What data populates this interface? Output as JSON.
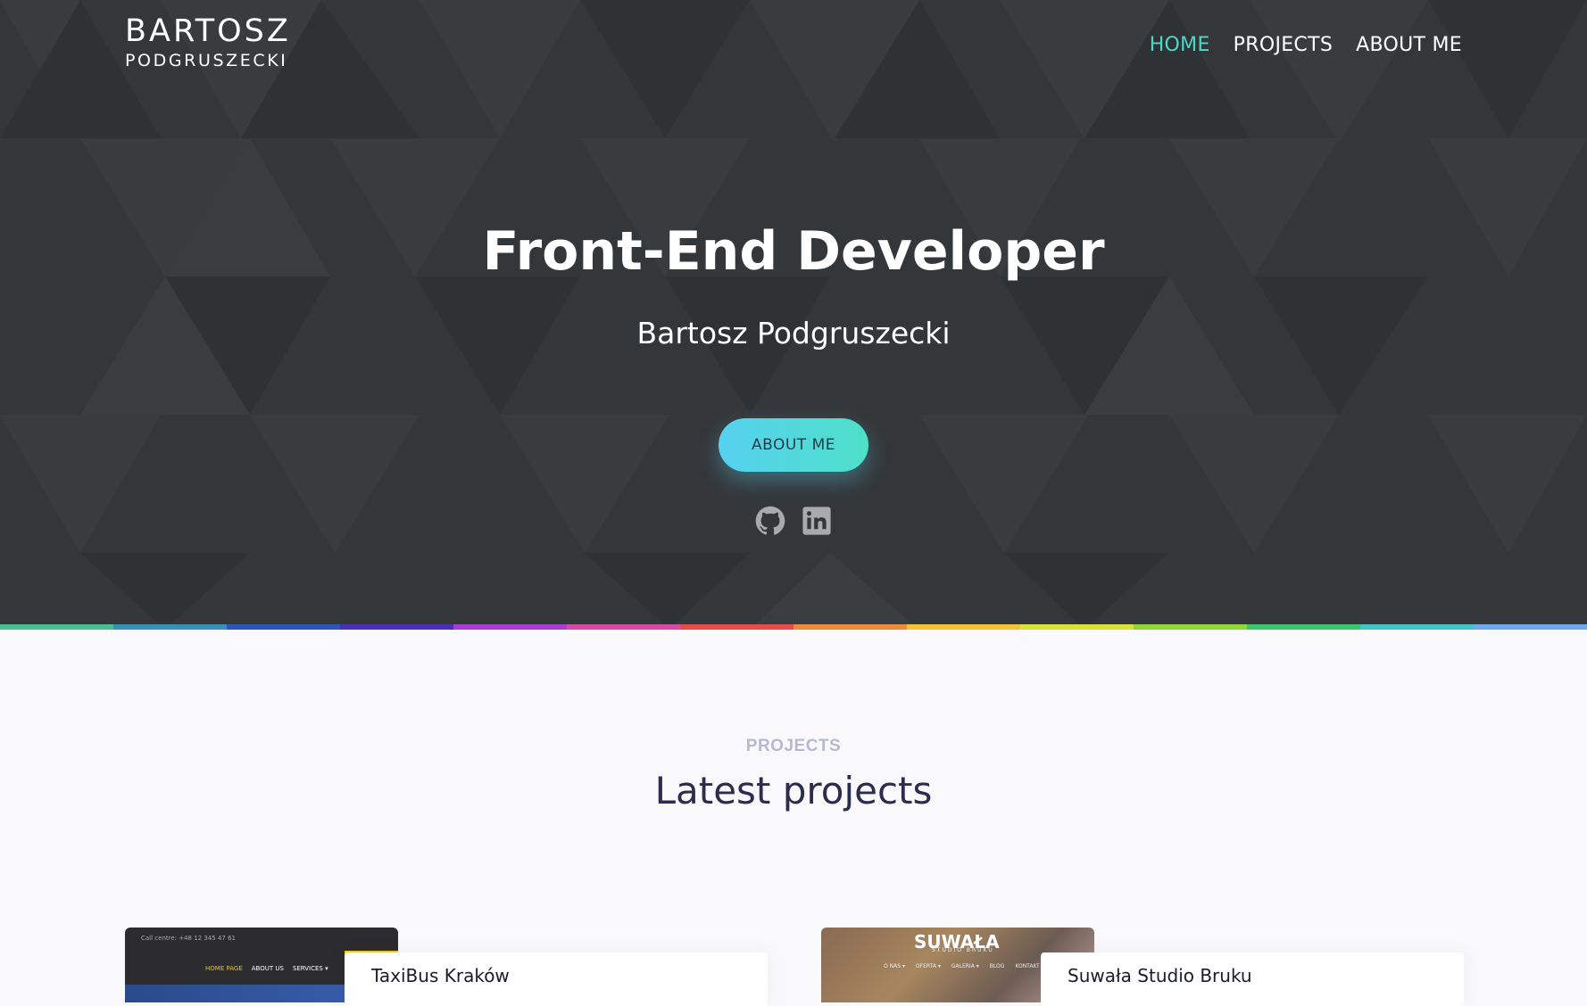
{
  "header": {
    "logo_first": "BARTOSZ",
    "logo_last": "PODGRUSZECKI",
    "nav": [
      {
        "label": "HOME",
        "active": true
      },
      {
        "label": "PROJECTS",
        "active": false
      },
      {
        "label": "ABOUT ME",
        "active": false
      }
    ]
  },
  "hero": {
    "title": "Front-End Developer",
    "subtitle": "Bartosz Podgruszecki",
    "cta_label": "ABOUT ME",
    "social": [
      "github-icon",
      "linkedin-icon"
    ]
  },
  "colors": {
    "hero_bg": "#34373a",
    "accent": "#4fd8c7",
    "cta_gradient_start": "#56d1f0",
    "cta_gradient_end": "#4ee0c8",
    "rainbow": [
      "#4cbd8f",
      "#3a8fb5",
      "#2b57b6",
      "#4a2fb4",
      "#a53fd1",
      "#d44aa5",
      "#e34c4c",
      "#ea8a3c",
      "#f0c33a",
      "#d8e03a",
      "#8fd63a",
      "#3ec46f",
      "#47c1c9",
      "#6fa9e9"
    ]
  },
  "projects": {
    "eyebrow": "PROJECTS",
    "title": "Latest projects",
    "items": [
      {
        "name": "TaxiBus Kraków",
        "thumb": {
          "call": "Call centre: +48 12 345 47 61",
          "menu": [
            "HOME PAGE",
            "ABOUT US",
            "SERVICES ▾"
          ]
        }
      },
      {
        "name": "Suwała Studio Bruku",
        "thumb": {
          "brand": "SUWAŁA",
          "sub": "STUDIO BRUKU",
          "menu": [
            "O NAS ▾",
            "OFERTA ▾",
            "GALERIA ▾",
            "BLOG",
            "KONTAKT"
          ]
        }
      }
    ]
  }
}
